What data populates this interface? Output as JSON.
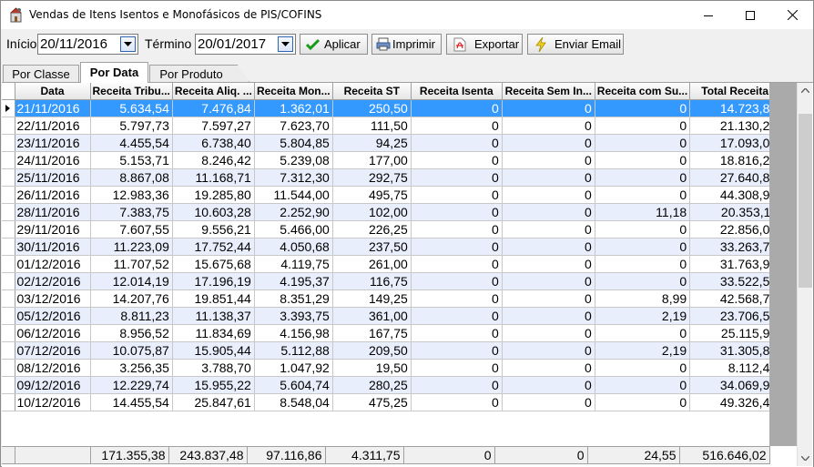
{
  "window": {
    "title": "Vendas de Itens Isentos e Monofásicos de PIS/COFINS",
    "icons": {
      "app": "app-icon",
      "minimize": "minimize-icon",
      "maximize": "maximize-icon",
      "close": "close-icon"
    }
  },
  "toolbar": {
    "start_label": "Início",
    "start_value": "20/11/2016",
    "end_label": "Término",
    "end_value": "20/01/2017",
    "apply_label": "Aplicar",
    "print_label": "Imprimir",
    "export_label": "Exportar",
    "email_label": "Enviar Email"
  },
  "tabs": [
    {
      "label": "Por Classe",
      "active": false
    },
    {
      "label": "Por Data",
      "active": true
    },
    {
      "label": "Por Produto",
      "active": false
    }
  ],
  "grid": {
    "columns": [
      "Data",
      "Receita Tribu...",
      "Receita Aliq. ...",
      "Receita Mon...",
      "Receita ST",
      "Receita Isenta",
      "Receita Sem In...",
      "Receita com Su...",
      "Total Receita"
    ],
    "rows": [
      [
        "21/11/2016",
        "5.634,54",
        "7.476,84",
        "1.362,01",
        "250,50",
        "0",
        "0",
        "0",
        "14.723,89"
      ],
      [
        "22/11/2016",
        "5.797,73",
        "7.597,27",
        "7.623,70",
        "111,50",
        "0",
        "0",
        "0",
        "21.130,20"
      ],
      [
        "23/11/2016",
        "4.455,54",
        "6.738,40",
        "5.804,85",
        "94,25",
        "0",
        "0",
        "0",
        "17.093,04"
      ],
      [
        "24/11/2016",
        "5.153,71",
        "8.246,42",
        "5.239,08",
        "177,00",
        "0",
        "0",
        "0",
        "18.816,21"
      ],
      [
        "25/11/2016",
        "8.867,08",
        "11.168,71",
        "7.312,30",
        "292,75",
        "0",
        "0",
        "0",
        "27.640,84"
      ],
      [
        "26/11/2016",
        "12.983,36",
        "19.285,80",
        "11.544,00",
        "495,75",
        "0",
        "0",
        "0",
        "44.308,91"
      ],
      [
        "28/11/2016",
        "7.383,75",
        "10.603,28",
        "2.252,90",
        "102,00",
        "0",
        "0",
        "11,18",
        "20.353,11"
      ],
      [
        "29/11/2016",
        "7.607,55",
        "9.556,21",
        "5.466,00",
        "226,25",
        "0",
        "0",
        "0",
        "22.856,01"
      ],
      [
        "30/11/2016",
        "11.223,09",
        "17.752,44",
        "4.050,68",
        "237,50",
        "0",
        "0",
        "0",
        "33.263,71"
      ],
      [
        "01/12/2016",
        "11.707,52",
        "15.675,68",
        "4.119,75",
        "261,00",
        "0",
        "0",
        "0",
        "31.763,95"
      ],
      [
        "02/12/2016",
        "12.014,19",
        "17.196,19",
        "4.195,37",
        "116,75",
        "0",
        "0",
        "0",
        "33.522,50"
      ],
      [
        "03/12/2016",
        "14.207,76",
        "19.851,44",
        "8.351,29",
        "149,25",
        "0",
        "0",
        "8,99",
        "42.568,73"
      ],
      [
        "05/12/2016",
        "8.811,23",
        "11.138,37",
        "3.393,75",
        "361,00",
        "0",
        "0",
        "2,19",
        "23.706,54"
      ],
      [
        "06/12/2016",
        "8.956,52",
        "11.834,69",
        "4.156,98",
        "167,75",
        "0",
        "0",
        "0",
        "25.115,94"
      ],
      [
        "07/12/2016",
        "10.075,87",
        "15.905,44",
        "5.112,88",
        "209,50",
        "0",
        "0",
        "2,19",
        "31.305,88"
      ],
      [
        "08/12/2016",
        "3.256,35",
        "3.788,70",
        "1.047,92",
        "19,50",
        "0",
        "0",
        "0",
        "8.112,47"
      ],
      [
        "09/12/2016",
        "12.229,74",
        "15.955,22",
        "5.604,74",
        "280,25",
        "0",
        "0",
        "0",
        "34.069,95"
      ],
      [
        "10/12/2016",
        "14.455,54",
        "25.847,61",
        "8.548,04",
        "475,25",
        "0",
        "0",
        "0",
        "49.326,44"
      ]
    ],
    "totals": [
      "",
      "171.355,38",
      "243.837,48",
      "97.116,86",
      "4.311,75",
      "0",
      "0",
      "24,55",
      "516.646,02"
    ],
    "selected_row": 0,
    "accent_color": "#3399ff",
    "alt_row_color": "#e8eefb"
  }
}
